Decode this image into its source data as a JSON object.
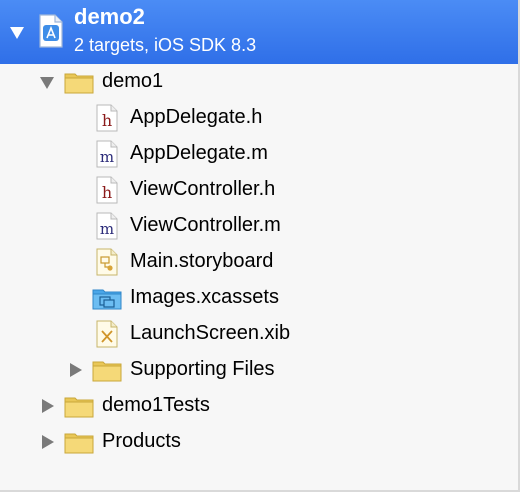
{
  "project": {
    "name": "demo2",
    "subtitle": "2 targets, iOS SDK 8.3"
  },
  "tree": {
    "group_demo1": "demo1",
    "files": [
      {
        "name": "AppDelegate.h",
        "icon": "header-file-icon"
      },
      {
        "name": "AppDelegate.m",
        "icon": "objc-source-file-icon"
      },
      {
        "name": "ViewController.h",
        "icon": "header-file-icon"
      },
      {
        "name": "ViewController.m",
        "icon": "objc-source-file-icon"
      },
      {
        "name": "Main.storyboard",
        "icon": "storyboard-file-icon"
      },
      {
        "name": "Images.xcassets",
        "icon": "asset-catalog-icon"
      },
      {
        "name": "LaunchScreen.xib",
        "icon": "xib-file-icon"
      }
    ],
    "supporting_files": "Supporting Files",
    "group_tests": "demo1Tests",
    "group_products": "Products",
    "header_letter": "h",
    "source_letter": "m"
  },
  "colors": {
    "selection": "#3a7bef",
    "folder": "#f2d270",
    "header_letter": "#8b1a1a",
    "source_letter": "#2c2c7a"
  }
}
